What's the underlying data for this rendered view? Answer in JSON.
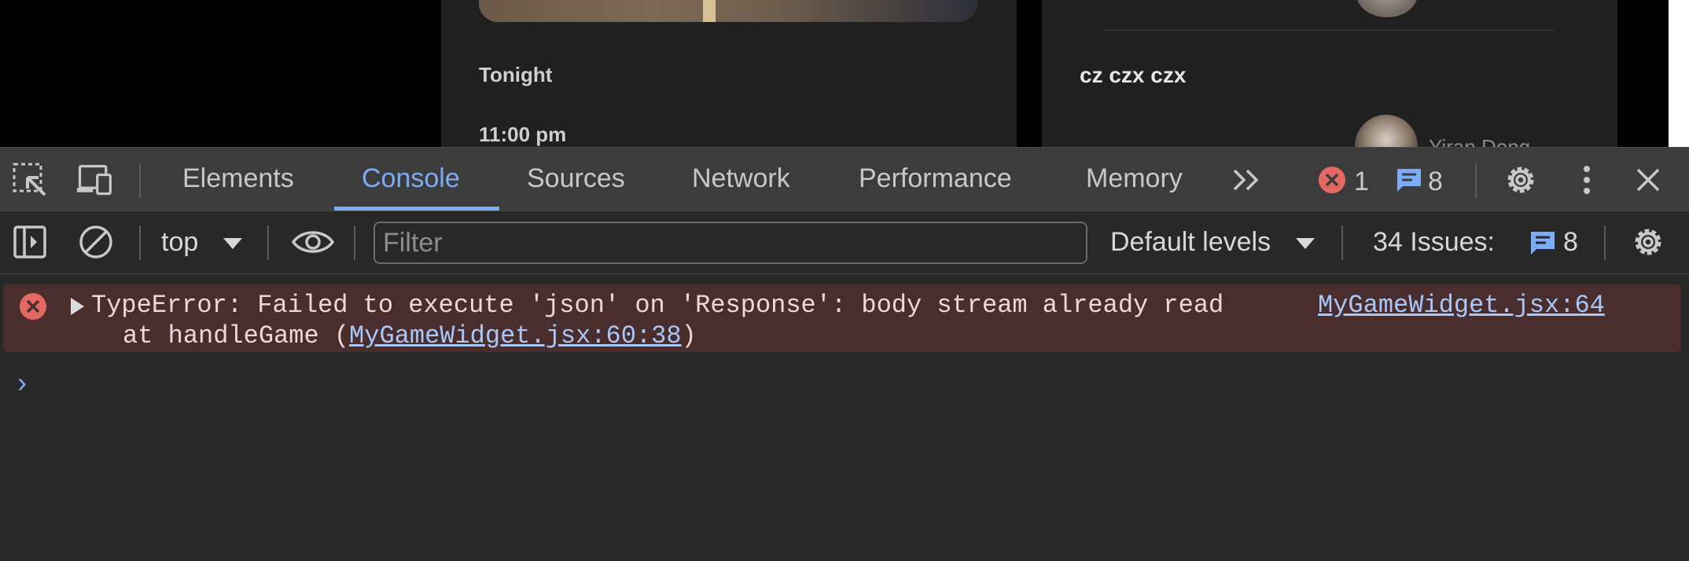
{
  "page": {
    "event_day": "Tonight",
    "event_time": "11:00 pm",
    "comment_text": "cz czx czx",
    "author": "Yiran Dong"
  },
  "devtools": {
    "tabs": [
      "Elements",
      "Console",
      "Sources",
      "Network",
      "Performance",
      "Memory"
    ],
    "active_tab": "Console",
    "more_tabs_icon": "chevron-double-right-icon",
    "error_count": "1",
    "message_count": "8"
  },
  "console_toolbar": {
    "context": "top",
    "filter_placeholder": "Filter",
    "levels_label": "Default levels",
    "issues_label": "34 Issues:",
    "issues_count": "8"
  },
  "console": {
    "messages": [
      {
        "level": "error",
        "text": "TypeError: Failed to execute 'json' on 'Response': body stream already read",
        "stack_prefix": "at handleGame (",
        "stack_link": "MyGameWidget.jsx:60:38",
        "stack_suffix": ")",
        "source": "MyGameWidget.jsx:64"
      }
    ],
    "prompt": "›"
  },
  "colors": {
    "accent": "#7cacf8",
    "error_bg": "#4a2d2d",
    "error_icon": "#e46962",
    "link": "#a8c7fa"
  }
}
